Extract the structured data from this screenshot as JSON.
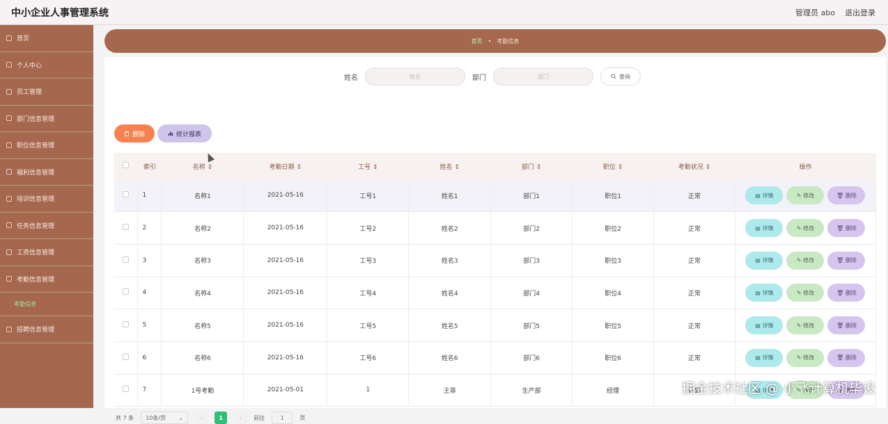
{
  "header": {
    "title": "中小企业人事管理系统",
    "user": "管理员 abo",
    "logout": "退出登录"
  },
  "sidebar": {
    "items": [
      {
        "label": "首页",
        "icon": "home-icon"
      },
      {
        "label": "个人中心",
        "icon": "user-icon"
      },
      {
        "label": "员工管理",
        "icon": "list-icon"
      },
      {
        "label": "部门信息管理",
        "icon": "building-icon"
      },
      {
        "label": "职位信息管理",
        "icon": "badge-icon"
      },
      {
        "label": "福利信息管理",
        "icon": "gift-icon"
      },
      {
        "label": "培训信息管理",
        "icon": "book-icon"
      },
      {
        "label": "任务信息管理",
        "icon": "task-icon"
      },
      {
        "label": "工资信息管理",
        "icon": "money-icon"
      },
      {
        "label": "考勤信息管理",
        "icon": "user-icon"
      }
    ],
    "sub_item": "考勤信息",
    "last_item": {
      "label": "招聘信息管理",
      "icon": "briefcase-icon"
    }
  },
  "breadcrumb": {
    "home": "首页",
    "current": "考勤信息"
  },
  "search": {
    "name_label": "姓名",
    "name_placeholder": "姓名",
    "dept_label": "部门",
    "dept_placeholder": "部门",
    "query_button": "查询"
  },
  "toolbar": {
    "delete_label": "删除",
    "report_label": "统计报表"
  },
  "table": {
    "headers": [
      "索引",
      "名称 ⇕",
      "考勤日期 ⇕",
      "工号 ⇕",
      "姓名 ⇕",
      "部门 ⇕",
      "职位 ⇕",
      "考勤状况 ⇕",
      "操作"
    ],
    "rows": [
      [
        "1",
        "名称1",
        "2021-05-16",
        "工号1",
        "姓名1",
        "部门1",
        "职位1",
        "正常"
      ],
      [
        "2",
        "名称2",
        "2021-05-16",
        "工号2",
        "姓名2",
        "部门2",
        "职位2",
        "正常"
      ],
      [
        "3",
        "名称3",
        "2021-05-16",
        "工号3",
        "姓名3",
        "部门3",
        "职位3",
        "正常"
      ],
      [
        "4",
        "名称4",
        "2021-05-16",
        "工号4",
        "姓名4",
        "部门4",
        "职位4",
        "正常"
      ],
      [
        "5",
        "名称5",
        "2021-05-16",
        "工号5",
        "姓名5",
        "部门5",
        "职位5",
        "正常"
      ],
      [
        "6",
        "名称6",
        "2021-05-16",
        "工号6",
        "姓名6",
        "部门6",
        "职位6",
        "正常"
      ],
      [
        "7",
        "1号考勤",
        "2021-05-01",
        "1",
        "王菲",
        "生产部",
        "经理",
        "迟到"
      ]
    ],
    "ops": {
      "detail": "详情",
      "edit": "修改",
      "delete": "删除"
    }
  },
  "pager": {
    "total": "共 7 条",
    "size": "10条/页",
    "current": "1",
    "goto_label": "前往",
    "goto_value": "1",
    "page_suffix": "页"
  },
  "watermark": "掘金技术社区 @ 小飞计算机毕设",
  "colors": {
    "sidebar": "#a5684f",
    "accent_green": "#2fbf76",
    "delete_orange": "#f7824f"
  }
}
